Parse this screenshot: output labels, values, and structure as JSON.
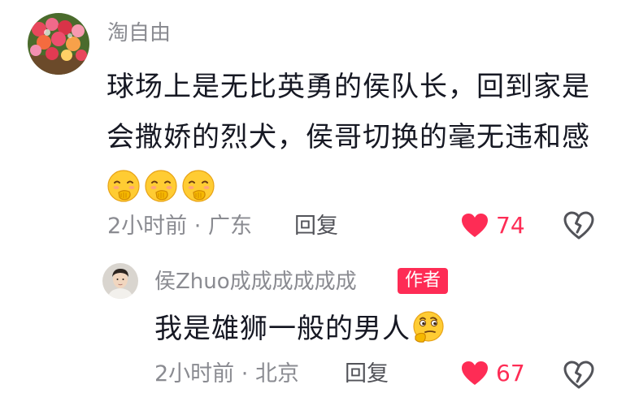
{
  "comment": {
    "username": "淘自由",
    "text": "球场上是无比英勇的侯队长，回到家是会撒娇的烈犬，侯哥切换的毫无违和感",
    "emojis": [
      "hand-over-mouth-giggle-emoji",
      "hand-over-mouth-giggle-emoji",
      "hand-over-mouth-giggle-emoji"
    ],
    "time": "2小时前",
    "separator": "·",
    "location": "广东",
    "reply_label": "回复",
    "like_count": "74",
    "avatar_icon": "flower-bouquet-avatar",
    "like_icon": "heart-icon",
    "dislike_icon": "broken-heart-icon"
  },
  "reply": {
    "username": "侯Zhuo成成成成成成",
    "badge": "作者",
    "text": "我是雄狮一般的男人",
    "emoji": "thinking-face-emoji",
    "time": "2小时前",
    "separator": "·",
    "location": "北京",
    "reply_label": "回复",
    "like_count": "67",
    "avatar_icon": "person-photo-avatar",
    "like_icon": "heart-icon",
    "dislike_icon": "broken-heart-icon"
  },
  "colors": {
    "like": "#fe2c55",
    "badge": "#fe2c55",
    "muted_text": "#8a8b91",
    "body_text": "#161823"
  }
}
